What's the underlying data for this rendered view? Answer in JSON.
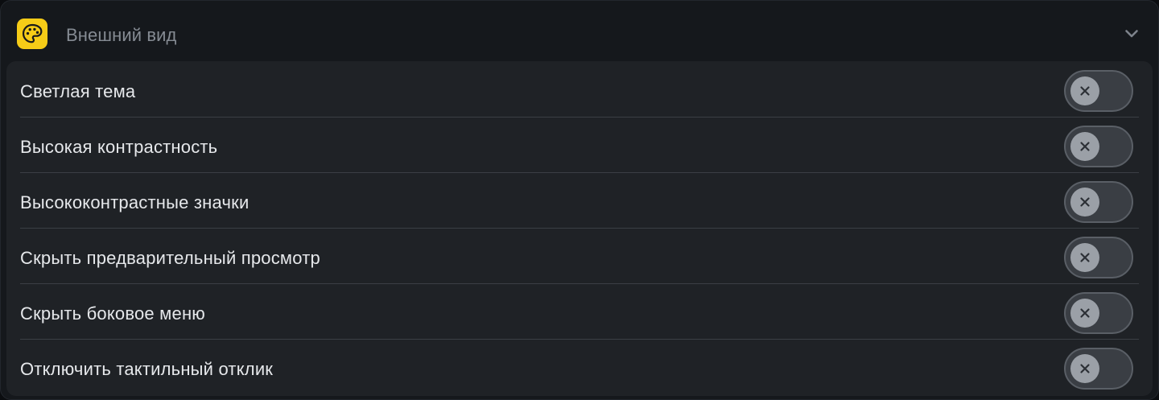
{
  "section": {
    "title": "Внешний вид",
    "icon": "palette-icon",
    "icon_color": "#f6cc17",
    "expand_icon": "chevron-down-icon",
    "expanded": true
  },
  "settings": [
    {
      "label": "Светлая тема",
      "enabled": false
    },
    {
      "label": "Высокая контрастность",
      "enabled": false
    },
    {
      "label": "Высококонтрастные значки",
      "enabled": false
    },
    {
      "label": "Скрыть предварительный просмотр",
      "enabled": false
    },
    {
      "label": "Скрыть боковое меню",
      "enabled": false
    },
    {
      "label": "Отключить тактильный отклик",
      "enabled": false
    }
  ],
  "toggle_off_icon": "x-icon"
}
